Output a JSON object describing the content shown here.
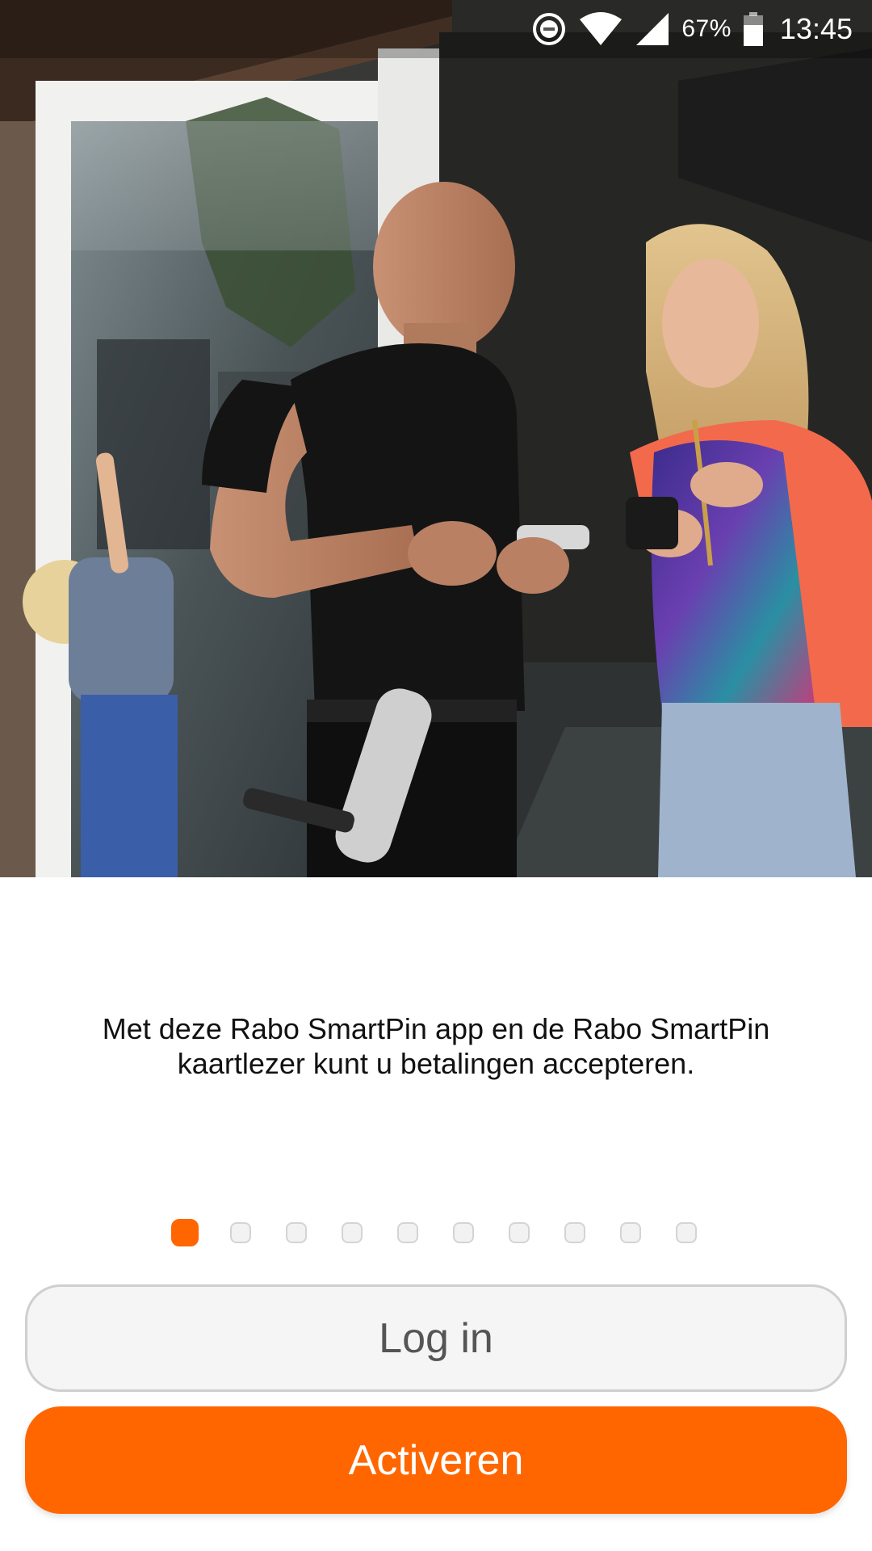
{
  "status_bar": {
    "icons": [
      "do-not-disturb-icon",
      "wifi-icon",
      "signal-icon",
      "battery-icon"
    ],
    "battery_percent": "67%",
    "time": "13:45"
  },
  "hero": {
    "image": "photo of a window cleaner and a woman using a card reader at a doorway"
  },
  "intro": {
    "description": "Met deze Rabo SmartPin app en de Rabo SmartPin kaartlezer kunt u betalingen accepteren."
  },
  "pager": {
    "total_pages": 10,
    "current_page": 1
  },
  "actions": {
    "login_label": "Log in",
    "activate_label": "Activeren"
  },
  "colors": {
    "accent": "#ff6600",
    "login_background": "#f5f5f5",
    "login_text": "#555555",
    "text": "#111111"
  }
}
